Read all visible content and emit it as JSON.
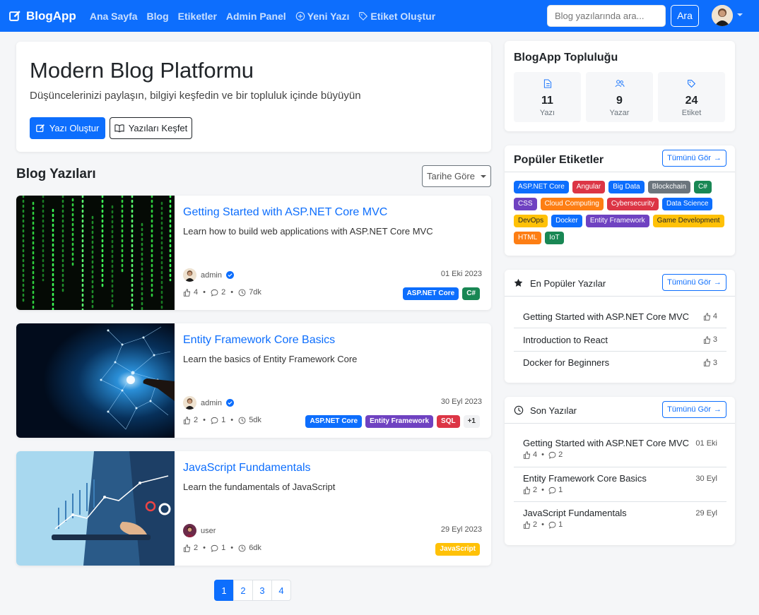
{
  "nav": {
    "brand": "BlogApp",
    "links": [
      "Ana Sayfa",
      "Blog",
      "Etiketler",
      "Admin Panel",
      "Yeni Yazı",
      "Etiket Oluştur"
    ],
    "search_placeholder": "Blog yazılarında ara...",
    "search_button": "Ara"
  },
  "hero": {
    "title": "Modern Blog Platformu",
    "subtitle": "Düşüncelerinizi paylaşın, bilgiyi keşfedin ve bir topluluk içinde büyüyün",
    "primary_button": "Yazı Oluştur",
    "secondary_button": "Yazıları Keşfet"
  },
  "posts_section": {
    "title": "Blog Yazıları",
    "sort_label": "Tarihe Göre"
  },
  "posts": [
    {
      "title": "Getting Started with ASP.NET Core MVC",
      "excerpt": "Learn how to build web applications with ASP.NET Core MVC",
      "author": "admin",
      "date": "01 Eki 2023",
      "likes": "4",
      "comments": "2",
      "views": "7dk",
      "tags": [
        {
          "name": "ASP.NET Core",
          "color": "#0d6efd"
        },
        {
          "name": "C#",
          "color": "#198754"
        }
      ]
    },
    {
      "title": "Entity Framework Core Basics",
      "excerpt": "Learn the basics of Entity Framework Core",
      "author": "admin",
      "date": "30 Eyl 2023",
      "likes": "2",
      "comments": "1",
      "views": "5dk",
      "tags": [
        {
          "name": "ASP.NET Core",
          "color": "#0d6efd"
        },
        {
          "name": "Entity Framework",
          "color": "#6f42c1"
        },
        {
          "name": "SQL",
          "color": "#dc3545"
        }
      ],
      "more": "+1"
    },
    {
      "title": "JavaScript Fundamentals",
      "excerpt": "Learn the fundamentals of JavaScript",
      "author": "user",
      "date": "29 Eyl 2023",
      "likes": "2",
      "comments": "1",
      "views": "6dk",
      "tags": [
        {
          "name": "JavaScript",
          "color": "#ffc107"
        }
      ]
    }
  ],
  "pagination": [
    "1",
    "2",
    "3",
    "4"
  ],
  "community": {
    "title": "BlogApp Topluluğu",
    "stats": [
      {
        "value": "11",
        "label": "Yazı",
        "icon": "file-icon"
      },
      {
        "value": "9",
        "label": "Yazar",
        "icon": "people-icon"
      },
      {
        "value": "24",
        "label": "Etiket",
        "icon": "tag-icon"
      }
    ]
  },
  "popular_tags": {
    "title": "Popüler Etiketler",
    "see_all": "Tümünü Gör",
    "tags": [
      {
        "name": "ASP.NET Core",
        "color": "#0d6efd"
      },
      {
        "name": "Angular",
        "color": "#dc3545"
      },
      {
        "name": "Big Data",
        "color": "#0d6efd"
      },
      {
        "name": "Blockchain",
        "color": "#6c757d"
      },
      {
        "name": "C#",
        "color": "#198754"
      },
      {
        "name": "CSS",
        "color": "#6f42c1"
      },
      {
        "name": "Cloud Computing",
        "color": "#fd7e14"
      },
      {
        "name": "Cybersecurity",
        "color": "#dc3545"
      },
      {
        "name": "Data Science",
        "color": "#0d6efd"
      },
      {
        "name": "DevOps",
        "color": "#ffc107"
      },
      {
        "name": "Docker",
        "color": "#0d6efd"
      },
      {
        "name": "Entity Framework",
        "color": "#6f42c1"
      },
      {
        "name": "Game Development",
        "color": "#ffc107"
      },
      {
        "name": "HTML",
        "color": "#fd7e14"
      },
      {
        "name": "IoT",
        "color": "#198754"
      }
    ]
  },
  "popular_posts": {
    "title": "En Popüler Yazılar",
    "see_all": "Tümünü Gör",
    "items": [
      {
        "title": "Getting Started with ASP.NET Core MVC",
        "likes": "4"
      },
      {
        "title": "Introduction to React",
        "likes": "3"
      },
      {
        "title": "Docker for Beginners",
        "likes": "3"
      }
    ]
  },
  "recent_posts": {
    "title": "Son Yazılar",
    "see_all": "Tümünü Gör",
    "items": [
      {
        "title": "Getting Started with ASP.NET Core MVC",
        "date": "01 Eki",
        "likes": "4",
        "comments": "2"
      },
      {
        "title": "Entity Framework Core Basics",
        "date": "30 Eyl",
        "likes": "2",
        "comments": "1"
      },
      {
        "title": "JavaScript Fundamentals",
        "date": "29 Eyl",
        "likes": "2",
        "comments": "1"
      }
    ]
  }
}
